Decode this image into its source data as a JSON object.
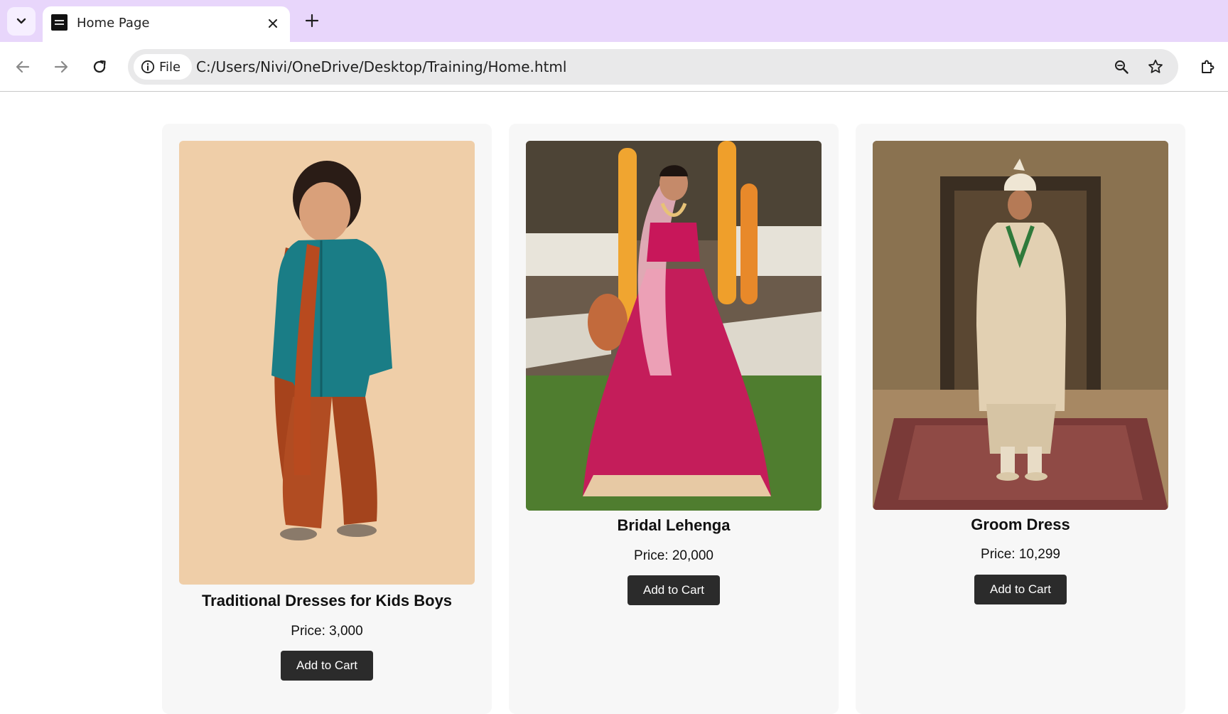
{
  "browser": {
    "tab": {
      "title": "Home Page"
    },
    "omnibox": {
      "chip_label": "File",
      "url": "C:/Users/Nivi/OneDrive/Desktop/Training/Home.html"
    },
    "icons": {
      "tab_search": "chevron-down-icon",
      "tab_close": "close-icon",
      "new_tab": "plus-icon",
      "back": "arrow-left-icon",
      "forward": "arrow-right-icon",
      "reload": "reload-icon",
      "site_info": "info-icon",
      "zoom": "zoom-icon",
      "bookmark": "star-icon",
      "extensions": "puzzle-icon"
    }
  },
  "colors": {
    "tabstrip": "#e8d6fb",
    "card_background": "#f7f7f7",
    "button_background": "#2b2b2b",
    "button_text": "#ffffff"
  },
  "products": [
    {
      "title": "Traditional Dresses for Kids Boys",
      "price": "Price: 3,000",
      "button": "Add to Cart"
    },
    {
      "title": "Bridal Lehenga",
      "price": "Price: 20,000",
      "button": "Add to Cart"
    },
    {
      "title": "Groom Dress",
      "price": "Price: 10,299",
      "button": "Add to Cart"
    }
  ]
}
